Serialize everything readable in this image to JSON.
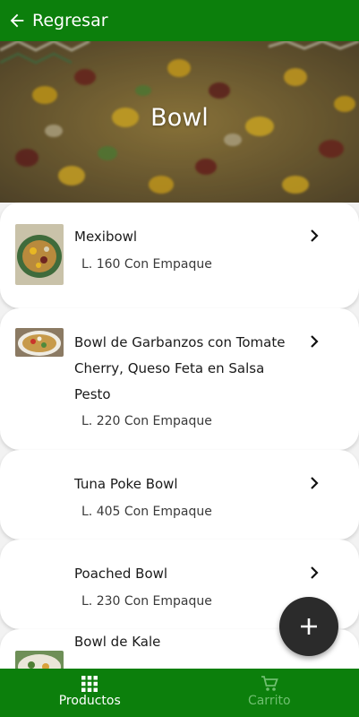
{
  "topbar": {
    "back_label": "Regresar",
    "icon": "arrow-left-icon",
    "color": "#0c7f0c"
  },
  "hero": {
    "title": "Bowl"
  },
  "products": [
    {
      "name": "Mexibowl",
      "price": "L. 160 Con Empaque",
      "has_image": true
    },
    {
      "name": "Bowl de Garbanzos con Tomate Cherry, Queso Feta en Salsa Pesto",
      "price": "L. 220 Con Empaque",
      "has_image": true
    },
    {
      "name": "Tuna Poke Bowl",
      "price": "L. 405 Con Empaque",
      "has_image": false
    },
    {
      "name": "Poached Bowl",
      "price": "L. 230 Con Empaque",
      "has_image": false
    },
    {
      "name": "Bowl de Kale",
      "price": "",
      "has_image": true
    }
  ],
  "fab": {
    "icon": "plus-icon"
  },
  "bottom_nav": {
    "tabs": [
      {
        "label": "Productos",
        "icon": "grid-icon",
        "active": true
      },
      {
        "label": "Carrito",
        "icon": "cart-icon",
        "active": false
      }
    ]
  }
}
